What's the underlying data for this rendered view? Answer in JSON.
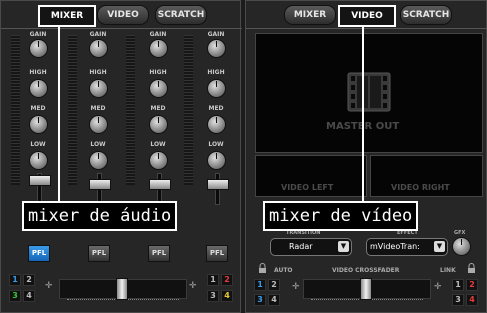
{
  "left_panel": {
    "tabs": [
      {
        "label": "MIXER",
        "active": true
      },
      {
        "label": "VIDEO",
        "active": false
      },
      {
        "label": "SCRATCH",
        "active": false
      }
    ],
    "knob_labels": [
      "GAIN",
      "HIGH",
      "MED",
      "LOW"
    ],
    "pfl_label": "PFL",
    "pfl_buttons": [
      {
        "label": "PFL",
        "active": true
      },
      {
        "label": "PFL",
        "active": false
      },
      {
        "label": "PFL",
        "active": false
      },
      {
        "label": "PFL",
        "active": false
      }
    ],
    "deck_numbers_left": [
      "1",
      "2",
      "3",
      "4"
    ],
    "deck_numbers_right": [
      "1",
      "2",
      "3",
      "4"
    ],
    "caption": "mixer de áudio"
  },
  "right_panel": {
    "tabs": [
      {
        "label": "MIXER",
        "active": false
      },
      {
        "label": "VIDEO",
        "active": true
      },
      {
        "label": "SCRATCH",
        "active": false
      }
    ],
    "master_out_label": "MASTER OUT",
    "video_left_label": "VIDEO LEFT",
    "video_right_label": "VIDEO RIGHT",
    "transition_header": "TRANSITION",
    "effect_header": "EFFECT",
    "gfx_header": "GFX",
    "transition_value": "Radar",
    "effect_value": "mVideoTran:",
    "auto_label": "AUTO",
    "crossfader_label": "VIDEO CROSSFADER",
    "link_label": "LINK",
    "deck_numbers_left": [
      "1",
      "2",
      "3",
      "4"
    ],
    "deck_numbers_right": [
      "1",
      "2",
      "3",
      "4"
    ],
    "caption": "mixer de vídeo"
  },
  "colors": {
    "deck1": "#3a9be8",
    "deck2": "#e83a3a",
    "deck3": "#3ac83a",
    "deck4": "#e8c83a",
    "neutral": "#bbbbbb"
  },
  "icons": [
    "film-strip-icon",
    "lock-icon",
    "chevron-down-icon",
    "plus-icon"
  ]
}
